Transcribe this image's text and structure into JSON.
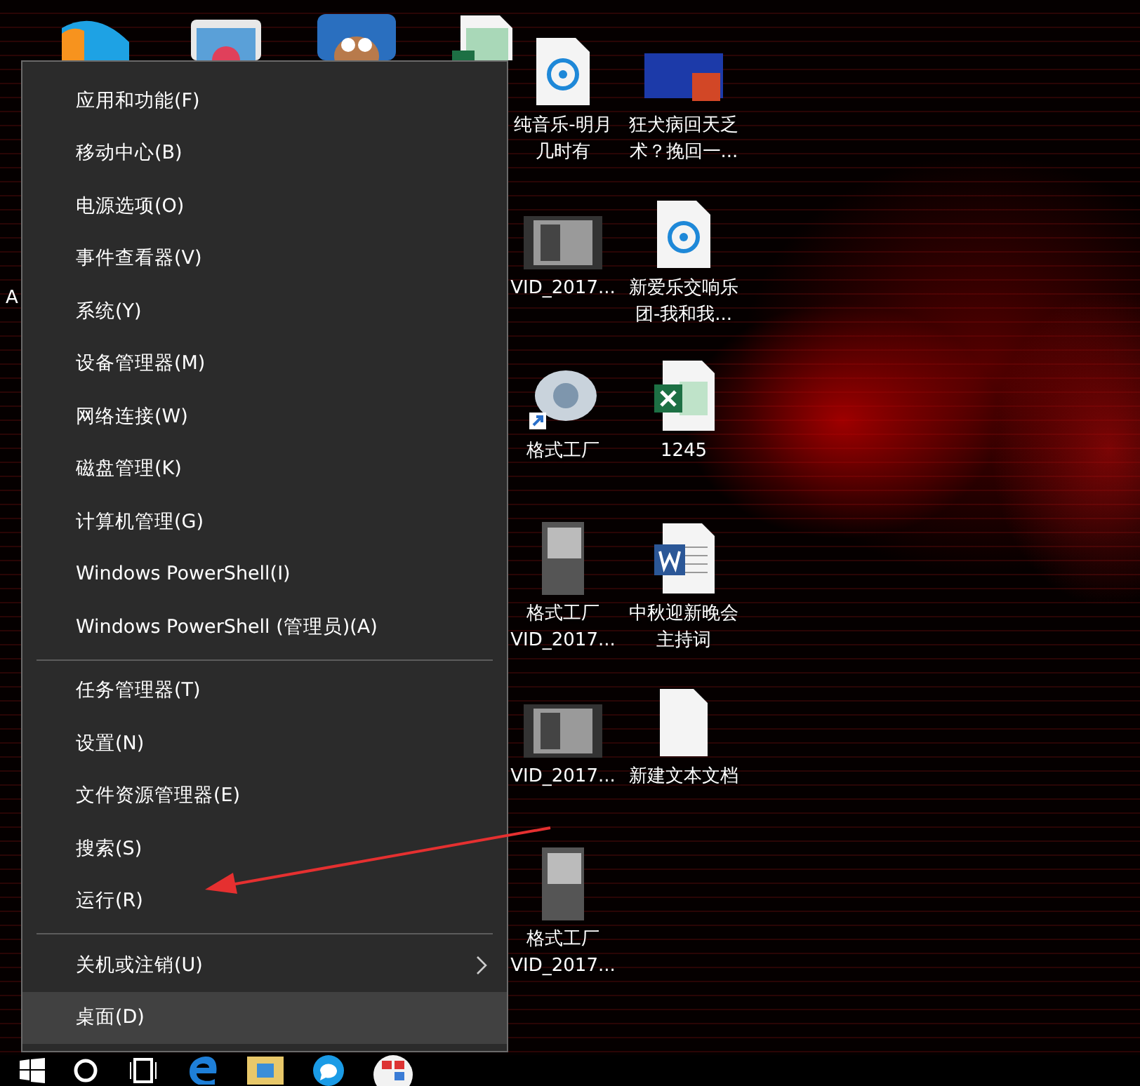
{
  "desktop": {
    "edge_label": "A",
    "hidden_icons": [
      {
        "kind": "video-app"
      },
      {
        "kind": "photos"
      },
      {
        "kind": "game"
      },
      {
        "kind": "sheet"
      }
    ],
    "icons": [
      {
        "kind": "audio",
        "lines": [
          "纯音乐-明月",
          "几时有"
        ]
      },
      {
        "kind": "slides",
        "lines": [
          "狂犬病回天乏",
          "术？挽回一..."
        ]
      },
      {
        "kind": "video",
        "lines": [
          "VID_2017..."
        ]
      },
      {
        "kind": "audio",
        "lines": [
          "新爱乐交响乐",
          "团-我和我..."
        ]
      },
      {
        "kind": "converter",
        "lines": [
          "格式工厂"
        ]
      },
      {
        "kind": "excel",
        "lines": [
          "1245"
        ]
      },
      {
        "kind": "photo-video",
        "lines": [
          "格式工厂",
          "VID_2017..."
        ]
      },
      {
        "kind": "word",
        "lines": [
          "中秋迎新晚会",
          "主持词"
        ]
      },
      {
        "kind": "video",
        "lines": [
          "VID_2017..."
        ]
      },
      {
        "kind": "text",
        "lines": [
          "新建文本文档"
        ]
      },
      {
        "kind": "photo-video",
        "lines": [
          "格式工厂",
          "VID_2017..."
        ]
      }
    ]
  },
  "menu": {
    "groups": [
      [
        {
          "label": "应用和功能(F)",
          "selected": false,
          "has_submenu": false
        },
        {
          "label": "移动中心(B)",
          "selected": false,
          "has_submenu": false
        },
        {
          "label": "电源选项(O)",
          "selected": false,
          "has_submenu": false
        },
        {
          "label": "事件查看器(V)",
          "selected": false,
          "has_submenu": false
        },
        {
          "label": "系统(Y)",
          "selected": false,
          "has_submenu": false
        },
        {
          "label": "设备管理器(M)",
          "selected": false,
          "has_submenu": false
        },
        {
          "label": "网络连接(W)",
          "selected": false,
          "has_submenu": false
        },
        {
          "label": "磁盘管理(K)",
          "selected": false,
          "has_submenu": false
        },
        {
          "label": "计算机管理(G)",
          "selected": false,
          "has_submenu": false
        },
        {
          "label": "Windows PowerShell(I)",
          "selected": false,
          "has_submenu": false
        },
        {
          "label": "Windows PowerShell (管理员)(A)",
          "selected": false,
          "has_submenu": false
        }
      ],
      [
        {
          "label": "任务管理器(T)",
          "selected": false,
          "has_submenu": false
        },
        {
          "label": "设置(N)",
          "selected": false,
          "has_submenu": false
        },
        {
          "label": "文件资源管理器(E)",
          "selected": false,
          "has_submenu": false
        },
        {
          "label": "搜索(S)",
          "selected": false,
          "has_submenu": false
        },
        {
          "label": "运行(R)",
          "selected": false,
          "has_submenu": false
        }
      ],
      [
        {
          "label": "关机或注销(U)",
          "selected": false,
          "has_submenu": true
        },
        {
          "label": "桌面(D)",
          "selected": true,
          "has_submenu": false
        }
      ]
    ]
  },
  "taskbar": {
    "items": [
      {
        "kind": "start"
      },
      {
        "kind": "search"
      },
      {
        "kind": "taskview"
      },
      {
        "kind": "browser"
      },
      {
        "kind": "folder"
      },
      {
        "kind": "chat"
      },
      {
        "kind": "app"
      }
    ]
  }
}
